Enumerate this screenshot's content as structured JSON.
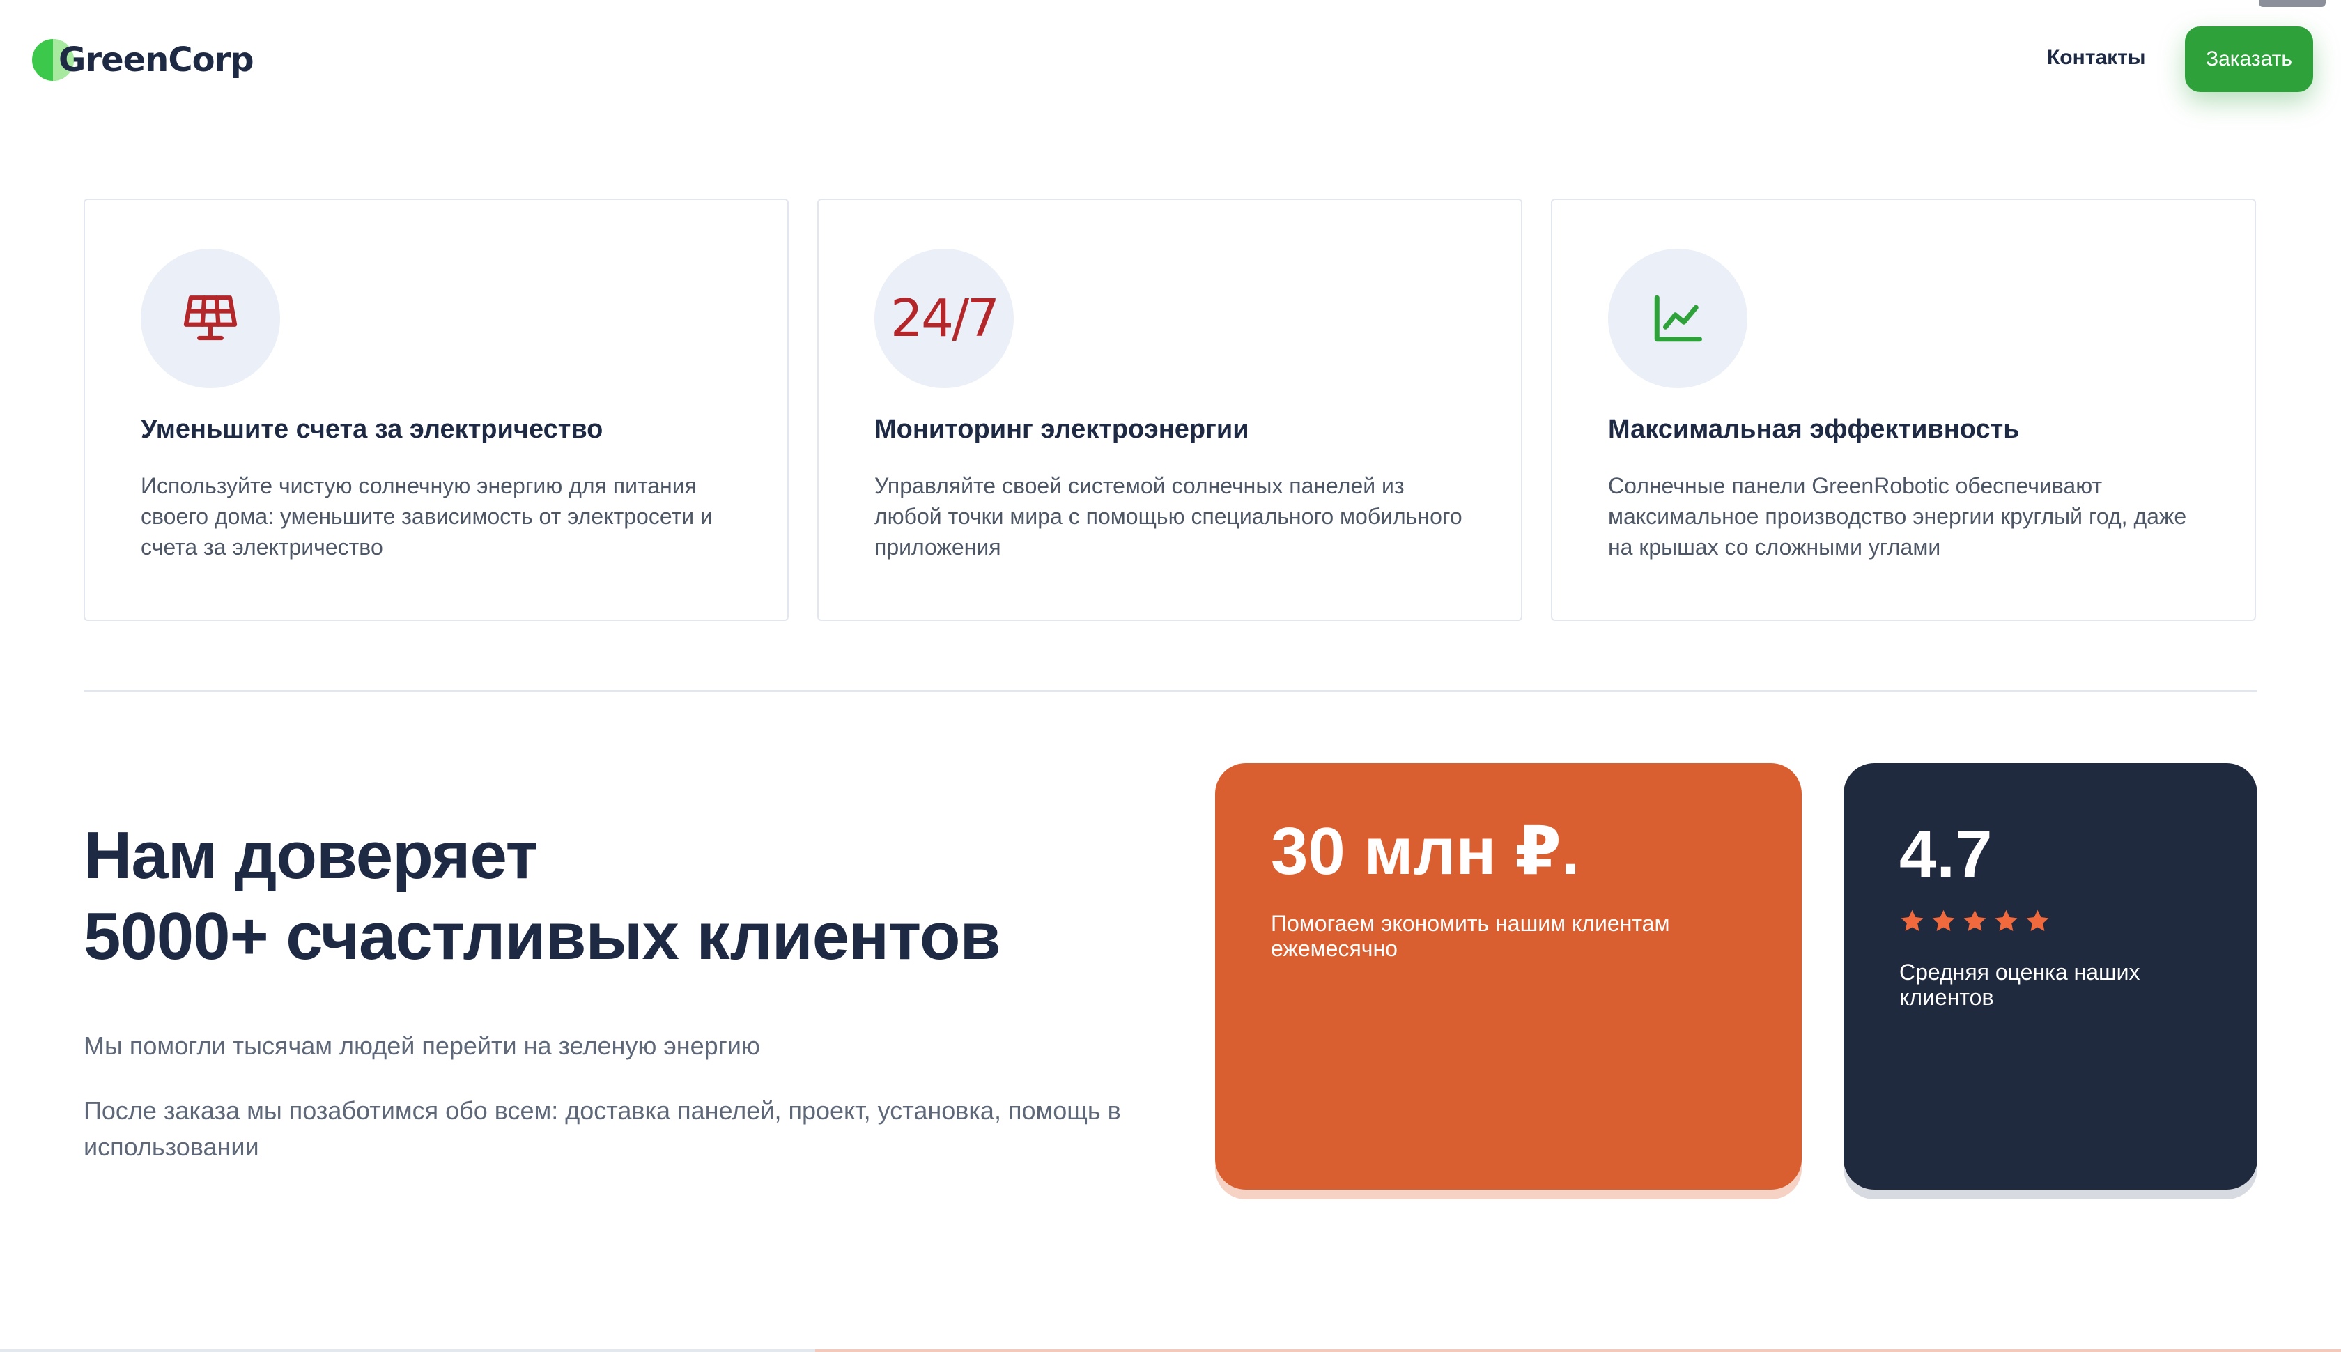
{
  "header": {
    "logo_text": "GreenCorp",
    "nav_contacts": "Контакты",
    "order_button": "Заказать"
  },
  "features": [
    {
      "icon": "solar-panel-icon",
      "title": "Уменьшите счета за электричество",
      "description": "Используйте чистую солнечную энергию для питания своего дома: уменьшите зависимость от электросети и счета за электричество"
    },
    {
      "icon": "24-7-icon",
      "icon_text": "24/7",
      "title": "Мониторинг электроэнергии",
      "description": "Управляйте своей системой солнечных панелей из любой точки мира с помощью специального мобильного приложения"
    },
    {
      "icon": "chart-line-icon",
      "title": "Максимальная эффективность",
      "description": "Солнечные панели GreenRobotic обеспечивают максимальное производство энергии круглый год, даже на крышах со сложными углами"
    }
  ],
  "trust": {
    "title_line1": "Нам доверяет",
    "title_line2": "5000+ счастливых клиентов",
    "subtitle1": "Мы помогли тысячам людей перейти на зеленую энергию",
    "subtitle2": "После заказа мы позаботимся обо всем: доставка панелей, проект, установка, помощь в использовании"
  },
  "stats": {
    "savings_value": "30 млн ₽.",
    "savings_label": "Помогаем экономить нашим клиентам ежемесячно",
    "rating_value": "4.7",
    "rating_stars": 5,
    "rating_label": "Средняя оценка наших клиентов"
  },
  "colors": {
    "brand_green": "#2ea13b",
    "navy": "#1e2a44",
    "orange": "#d95f30",
    "dark_card": "#1f2a3e",
    "icon_red": "#b3262a",
    "star": "#f06a3e"
  }
}
